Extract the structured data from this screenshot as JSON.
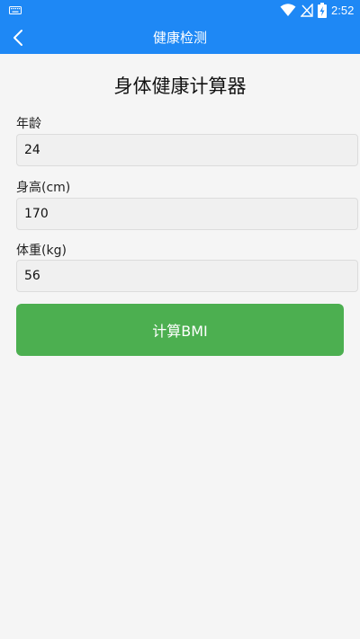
{
  "status_bar": {
    "time": "2:52",
    "icons": [
      "keyboard-icon",
      "wifi-icon",
      "no-signal-icon",
      "battery-charging-icon"
    ]
  },
  "app_bar": {
    "title": "健康检测",
    "back_icon": "chevron-left-icon",
    "color": "#1e88f5"
  },
  "calculator": {
    "title": "身体健康计算器",
    "fields": [
      {
        "label": "年龄",
        "value": "24"
      },
      {
        "label": "身高(cm)",
        "value": "170"
      },
      {
        "label": "体重(kg)",
        "value": "56"
      }
    ],
    "button_label": "计算BMI",
    "button_color": "#4caf50"
  }
}
